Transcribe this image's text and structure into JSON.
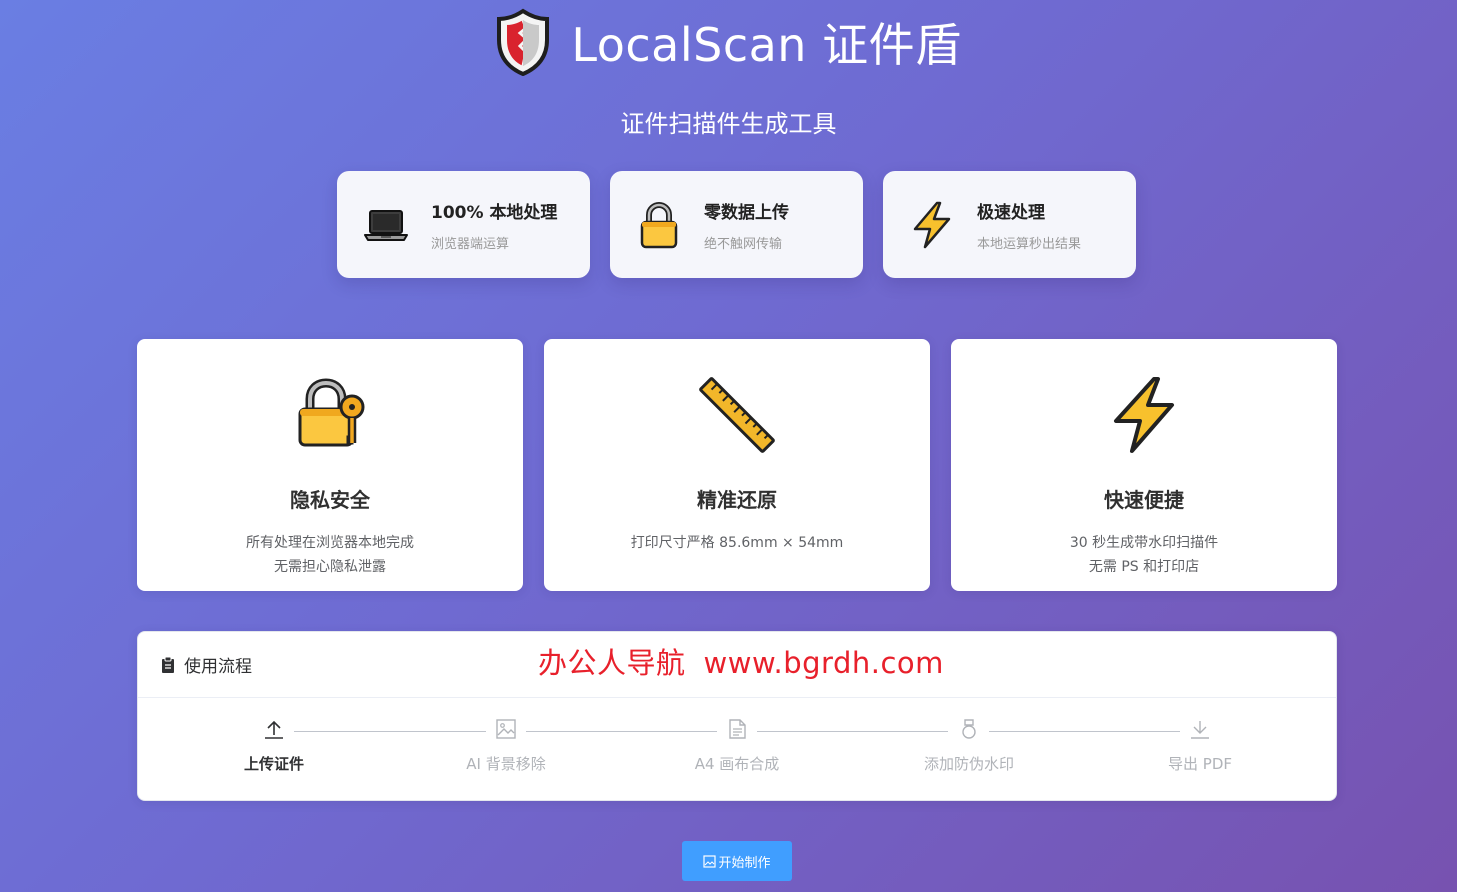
{
  "header": {
    "title": "LocalScan 证件盾",
    "subtitle": "证件扫描件生成工具",
    "logo_icon": "shield-icon"
  },
  "features": [
    {
      "icon": "laptop-icon",
      "title": "100% 本地处理",
      "desc": "浏览器端运算"
    },
    {
      "icon": "lock-icon",
      "title": "零数据上传",
      "desc": "绝不触网传输"
    },
    {
      "icon": "lightning-icon",
      "title": "极速处理",
      "desc": "本地运算秒出结果"
    }
  ],
  "cards": [
    {
      "icon": "lock-key-icon",
      "title": "隐私安全",
      "desc1": "所有处理在浏览器本地完成",
      "desc2": "无需担心隐私泄露"
    },
    {
      "icon": "ruler-icon",
      "title": "精准还原",
      "desc1": "打印尺寸严格 85.6mm × 54mm",
      "desc2": ""
    },
    {
      "icon": "lightning-icon",
      "title": "快速便捷",
      "desc1": "30 秒生成带水印扫描件",
      "desc2": "无需 PS 和打印店"
    }
  ],
  "process": {
    "title": "使用流程",
    "icon": "clipboard-icon",
    "watermark_text": "办公人导航",
    "watermark_url": "www.bgrdh.com",
    "steps": [
      {
        "icon": "upload-icon",
        "label": "上传证件",
        "active": true
      },
      {
        "icon": "image-icon",
        "label": "AI 背景移除",
        "active": false
      },
      {
        "icon": "document-icon",
        "label": "A4 画布合成",
        "active": false
      },
      {
        "icon": "stamp-icon",
        "label": "添加防伪水印",
        "active": false
      },
      {
        "icon": "download-icon",
        "label": "导出 PDF",
        "active": false
      }
    ]
  },
  "start_button": {
    "label": "开始制作",
    "icon": "picture-icon"
  },
  "colors": {
    "accent": "#409eff",
    "watermark": "#e8202b",
    "lightning": "#f8c12d",
    "lock": "#fbc740"
  }
}
